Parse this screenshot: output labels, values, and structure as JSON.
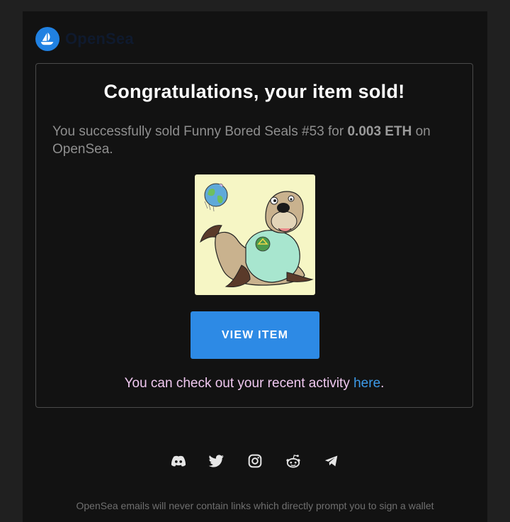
{
  "brand": {
    "name": "OpenSea",
    "logo_icon": "opensea-sailboat-icon",
    "color": "#2081e2"
  },
  "card": {
    "title": "Congratulations, your item sold!",
    "message_prefix": "You successfully sold Funny Bored Seals #53 for ",
    "price": "0.003 ETH",
    "message_suffix": " on OpenSea.",
    "image_alt": "Funny Bored Seals #53",
    "button_label": "VIEW ITEM",
    "activity_prefix": "You can check out your recent activity ",
    "activity_link": "here",
    "activity_suffix": "."
  },
  "socials": [
    {
      "icon": "discord-icon"
    },
    {
      "icon": "twitter-icon"
    },
    {
      "icon": "instagram-icon"
    },
    {
      "icon": "reddit-icon"
    },
    {
      "icon": "telegram-icon"
    }
  ],
  "footer": {
    "text": "OpenSea emails will never contain links which directly prompt you to sign a wallet"
  },
  "colors": {
    "accent": "#2d8ae5",
    "link": "#3d9be9",
    "background": "#121212"
  }
}
